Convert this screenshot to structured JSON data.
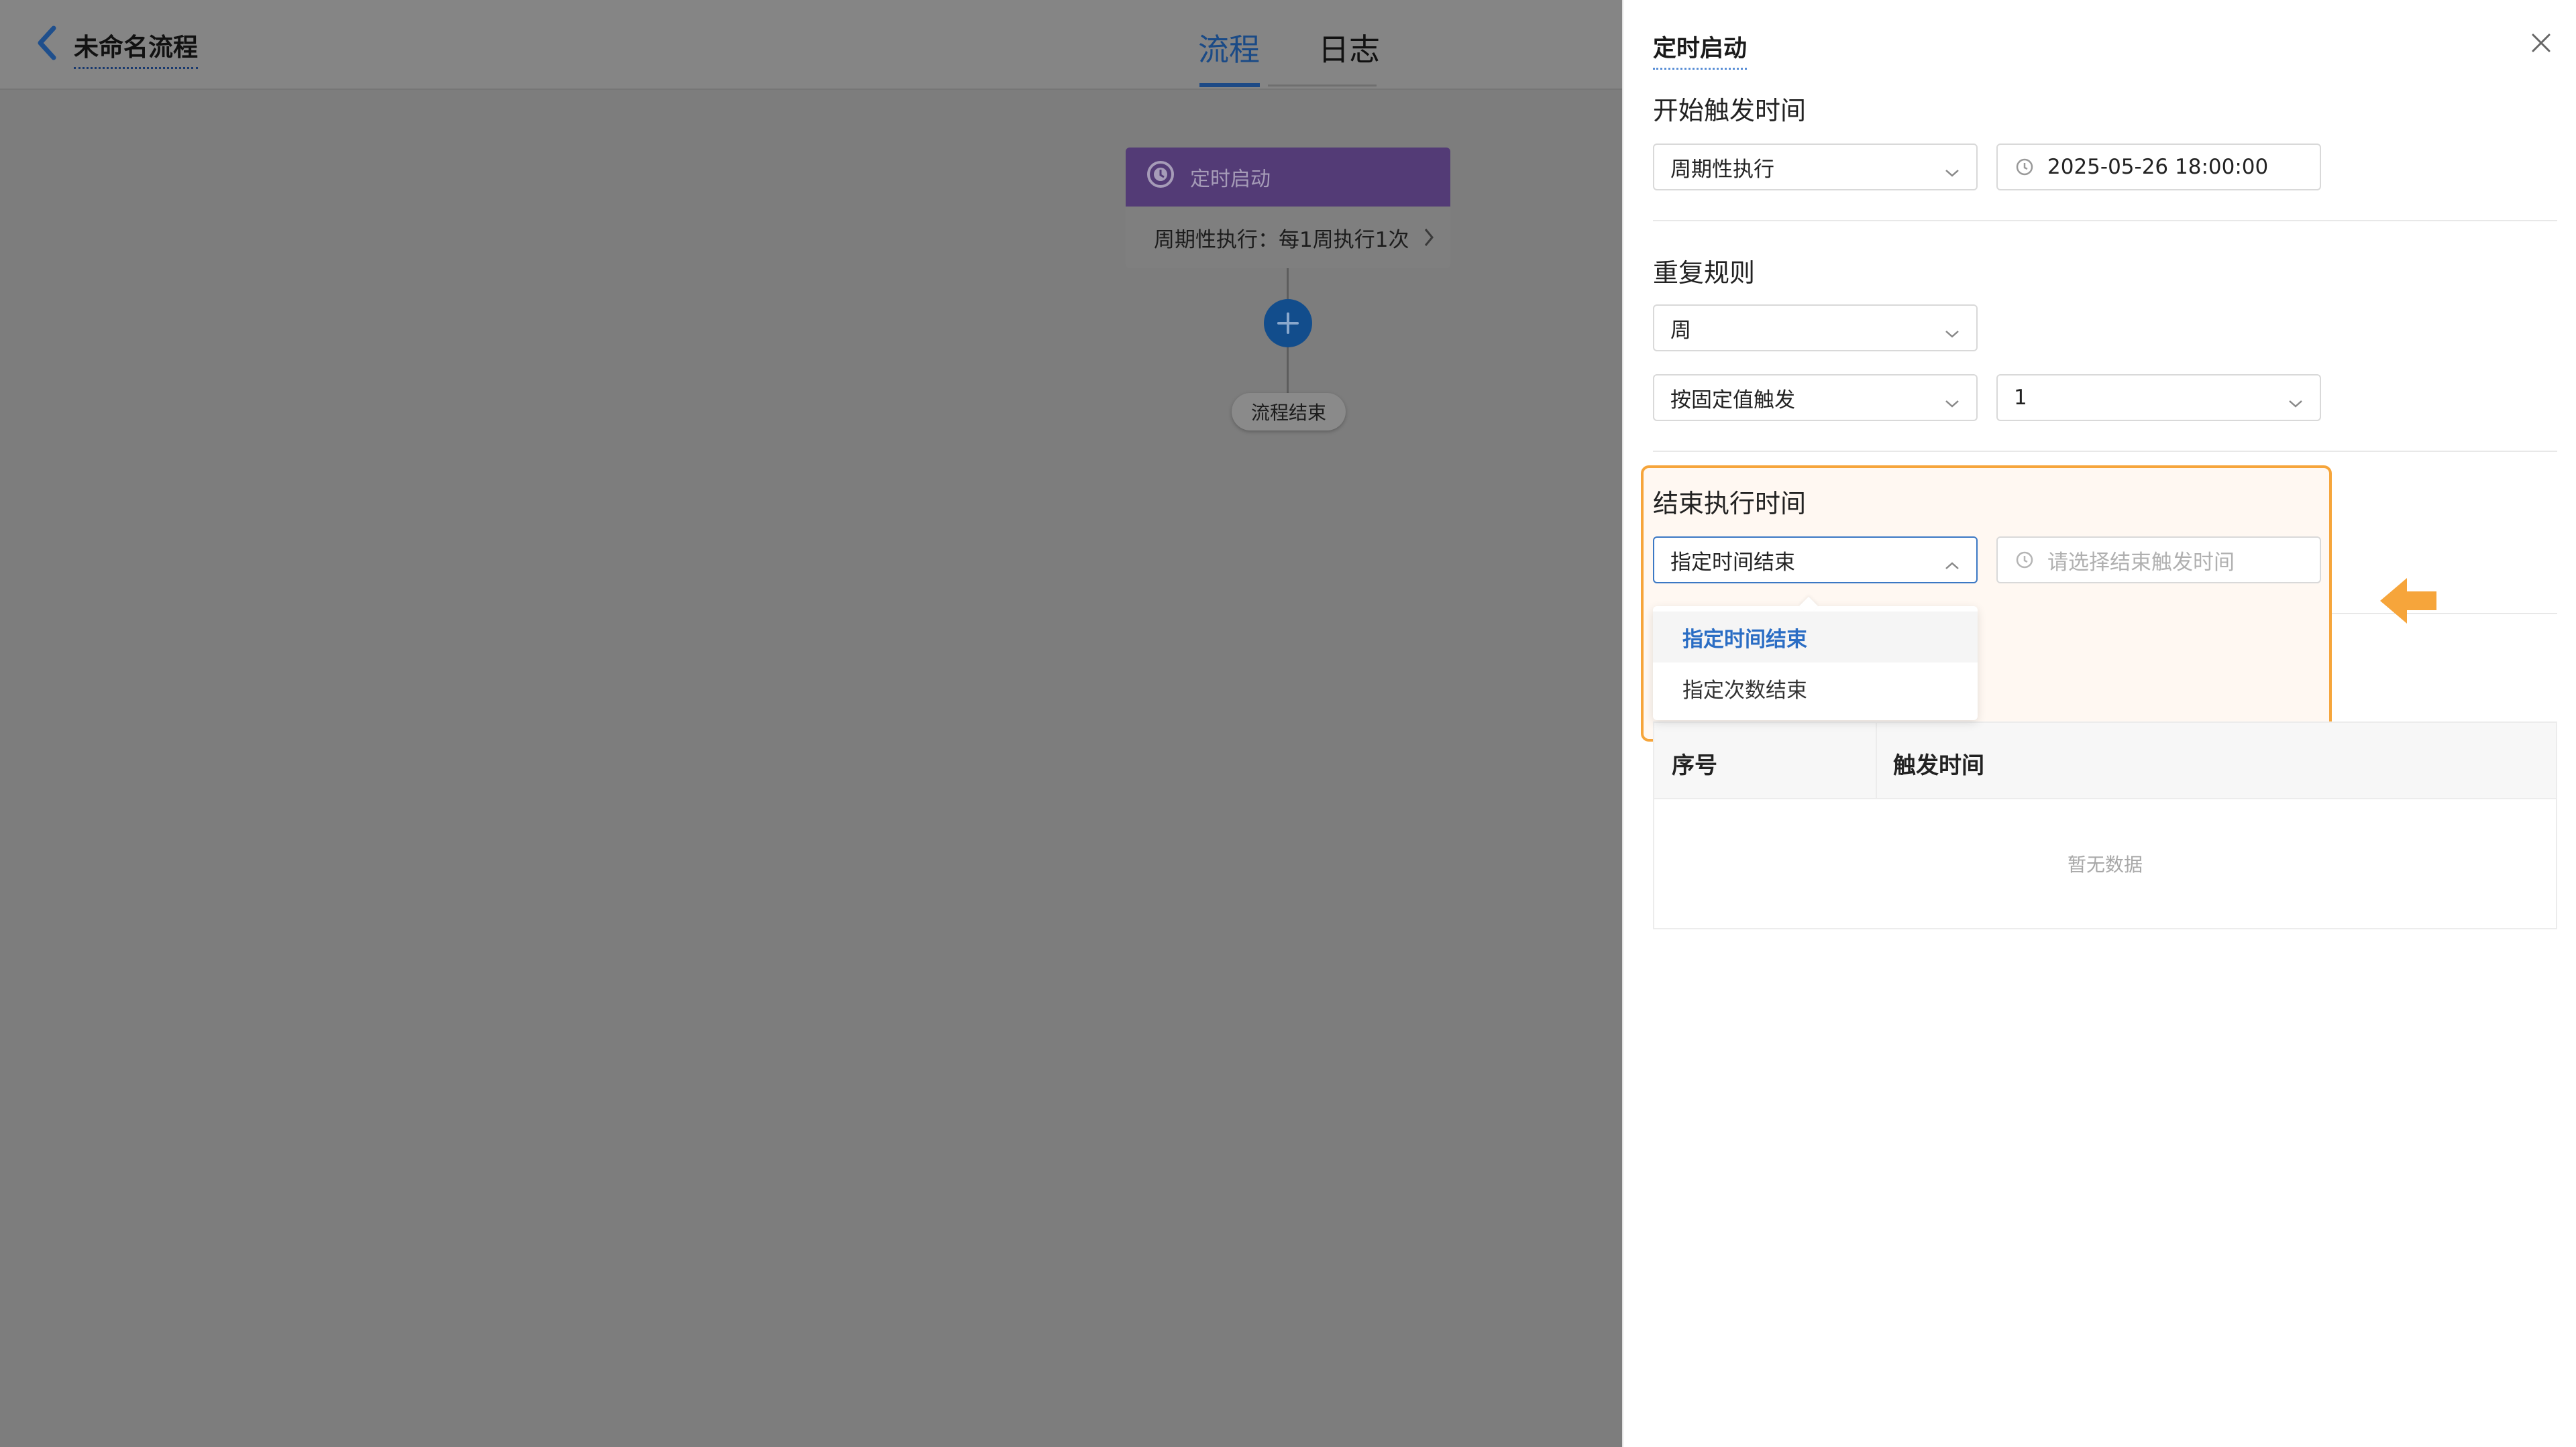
{
  "header": {
    "title": "未命名流程",
    "tabs": [
      {
        "label": "流程",
        "active": true
      },
      {
        "label": "日志",
        "active": false
      }
    ]
  },
  "canvas": {
    "trigger_node": {
      "title": "定时启动",
      "summary": "周期性执行：每1周执行1次",
      "icon": "clock-icon",
      "header_color": "#533b76"
    },
    "end_node": {
      "label": "流程结束"
    },
    "add_button_icon": "plus-icon"
  },
  "drawer": {
    "title": "定时启动",
    "start": {
      "label": "开始触发时间",
      "mode": "周期性执行",
      "datetime": "2025-05-26 18:00:00"
    },
    "repeat": {
      "label": "重复规则",
      "unit": "周",
      "trigger_mode": "按固定值触发",
      "value": "1"
    },
    "end": {
      "label": "结束执行时间",
      "mode": "指定时间结束",
      "time_placeholder": "请选择结束触发时间",
      "options": [
        "指定时间结束",
        "指定次数结束"
      ]
    },
    "table": {
      "columns": [
        "序号",
        "触发时间"
      ],
      "empty_text": "暂无数据"
    }
  },
  "colors": {
    "accent": "#2a6dc4",
    "highlight_border": "#f6a53b",
    "overlay": "#7d7d7d"
  }
}
